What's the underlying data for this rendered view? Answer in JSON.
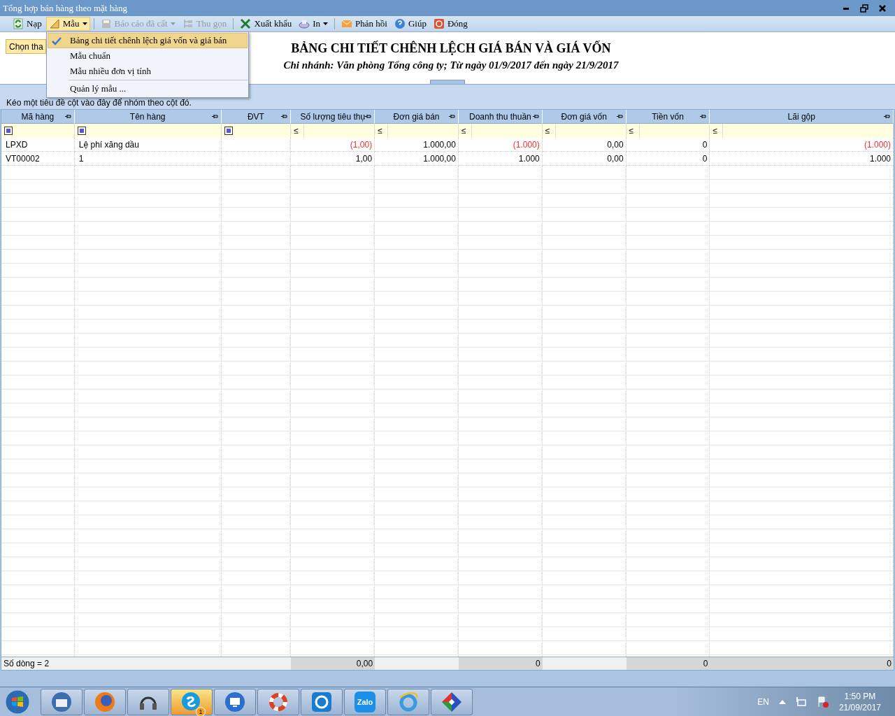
{
  "window": {
    "title": "Tổng hợp bán hàng theo mặt hàng"
  },
  "toolbar": [
    {
      "label": "Nạp",
      "disabled": false,
      "dropdown": false,
      "active": false
    },
    {
      "label": "Mẫu",
      "disabled": false,
      "dropdown": true,
      "active": true
    },
    {
      "label": "Báo cáo đã cất",
      "disabled": true,
      "dropdown": true,
      "active": false
    },
    {
      "label": "Thu gọn",
      "disabled": true,
      "dropdown": false,
      "active": false
    },
    {
      "label": "Xuất khẩu",
      "disabled": false,
      "dropdown": false,
      "active": false
    },
    {
      "label": "In",
      "disabled": false,
      "dropdown": true,
      "active": false
    },
    {
      "label": "Phản hồi",
      "disabled": false,
      "dropdown": false,
      "active": false
    },
    {
      "label": "Giúp",
      "disabled": false,
      "dropdown": false,
      "active": false
    },
    {
      "label": "Đóng",
      "disabled": false,
      "dropdown": false,
      "active": false
    }
  ],
  "template_menu": {
    "items": [
      {
        "label": "Bảng chi tiết chênh lệch giá vốn và giá bán",
        "checked": true,
        "selected": true,
        "separator_before": false
      },
      {
        "label": "Mẫu chuẩn",
        "checked": false,
        "selected": false,
        "separator_before": false
      },
      {
        "label": "Mẫu nhiều đơn vị tính",
        "checked": false,
        "selected": false,
        "separator_before": false
      },
      {
        "label": "Quản lý mẫu ...",
        "checked": false,
        "selected": false,
        "separator_before": true
      }
    ]
  },
  "options_button": "Chọn tha",
  "report": {
    "title": "BẢNG CHI TIẾT CHÊNH LỆCH GIÁ BÁN VÀ GIÁ VỐN",
    "subtitle": "Chi nhánh: Văn phòng Tổng công ty; Từ ngày 01/9/2017 đến ngày 21/9/2017"
  },
  "group_panel_hint": "Kéo một tiêu đề cột vào đây để nhóm theo cột đó.",
  "table": {
    "columns": [
      {
        "label": "Mã hàng",
        "filter": {
          "kind": "checkbox",
          "checked": true
        }
      },
      {
        "label": "Tên hàng",
        "filter": {
          "kind": "checkbox",
          "checked": true
        }
      },
      {
        "label": "ĐVT",
        "filter": {
          "kind": "checkbox",
          "checked": true
        }
      },
      {
        "label": "Số lượng tiêu thụ",
        "filter": {
          "kind": "operator",
          "symbol": "≤"
        }
      },
      {
        "label": "Đơn giá bán",
        "filter": {
          "kind": "operator",
          "symbol": "≤"
        }
      },
      {
        "label": "Doanh thu thuần",
        "filter": {
          "kind": "operator",
          "symbol": "≤"
        }
      },
      {
        "label": "Đơn giá vốn",
        "filter": {
          "kind": "operator",
          "symbol": "≤"
        }
      },
      {
        "label": "Tiền vốn",
        "filter": {
          "kind": "operator",
          "symbol": "≤"
        }
      },
      {
        "label": "Lãi gộp",
        "filter": {
          "kind": "operator",
          "symbol": "≤"
        }
      }
    ],
    "rows": [
      {
        "ma_hang": "LPXD",
        "ten_hang": "Lệ phí xăng dầu",
        "so_luong": {
          "text": "(1,00)",
          "negative": true
        },
        "don_gia_ban": {
          "text": "1.000,00",
          "negative": false
        },
        "doanh_thu": {
          "text": "(1.000)",
          "negative": true
        },
        "don_gia_von": {
          "text": "0,00",
          "negative": false
        },
        "tien_von": {
          "text": "0",
          "negative": false
        },
        "lai_gop": {
          "text": "(1.000)",
          "negative": true
        }
      },
      {
        "ma_hang": "VT00002",
        "ten_hang": "1",
        "so_luong": {
          "text": "1,00",
          "negative": false
        },
        "don_gia_ban": {
          "text": "1.000,00",
          "negative": false
        },
        "doanh_thu": {
          "text": "1.000",
          "negative": false
        },
        "don_gia_von": {
          "text": "0,00",
          "negative": false
        },
        "tien_von": {
          "text": "0",
          "negative": false
        },
        "lai_gop": {
          "text": "1.000",
          "negative": false
        }
      }
    ],
    "footer": {
      "row_count": "Số dòng = 2",
      "so_luong": "0,00",
      "doanh_thu": "0",
      "tien_von": "0",
      "lai_gop": "0"
    }
  },
  "taskbar": {
    "apps": [
      {
        "active": false
      },
      {
        "active": false
      },
      {
        "active": false
      },
      {
        "active": true,
        "badge": "1"
      },
      {
        "active": false
      },
      {
        "active": false
      },
      {
        "active": false
      },
      {
        "active": false,
        "label": "Zalo"
      },
      {
        "active": false
      },
      {
        "active": false
      }
    ],
    "language": "EN",
    "time": "1:50 PM",
    "date": "21/09/2017"
  }
}
